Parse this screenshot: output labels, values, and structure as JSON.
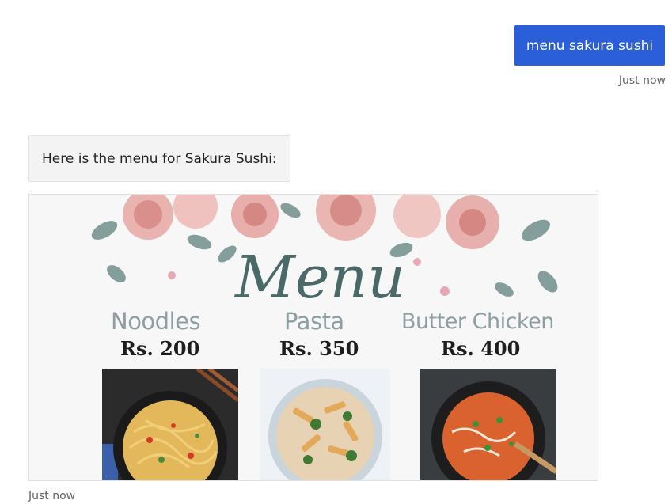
{
  "user_message": {
    "text": "menu sakura sushi",
    "timestamp": "Just now"
  },
  "bot_message": {
    "text": "Here is the menu for Sakura Sushi:",
    "timestamp": "Just now"
  },
  "menu_image": {
    "heading": "Menu",
    "dishes": [
      {
        "name": "Noodles",
        "price": "Rs. 200"
      },
      {
        "name": "Pasta",
        "price": "Rs. 350"
      },
      {
        "name": "Butter Chicken",
        "price": "Rs. 400"
      }
    ]
  },
  "colors": {
    "user_bubble": "#2b5fd9",
    "bot_bubble": "#f3f3f3",
    "timestamp": "#616161"
  }
}
